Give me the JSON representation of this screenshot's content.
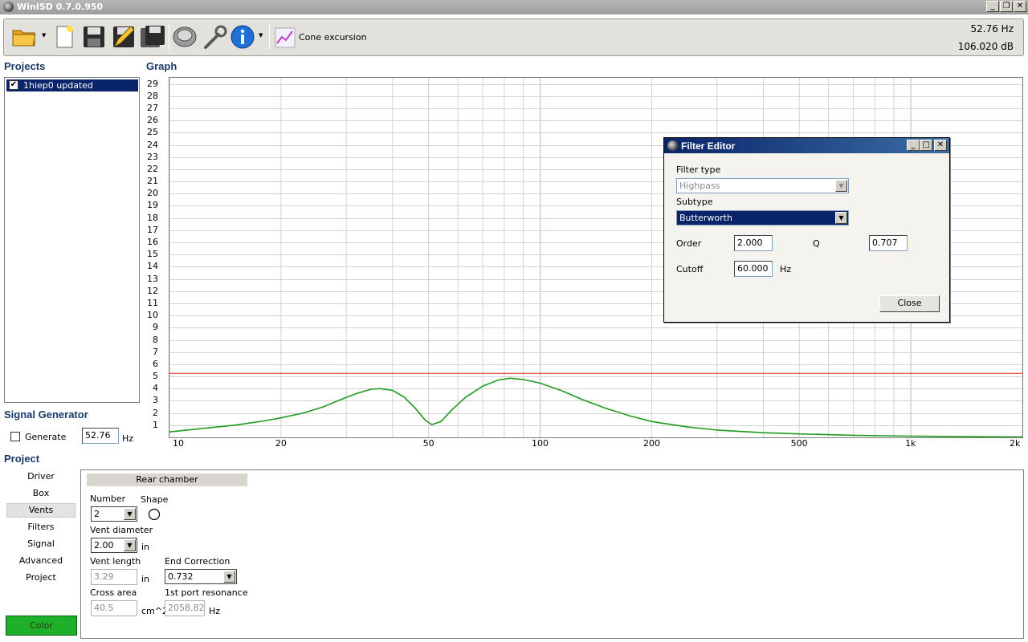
{
  "window": {
    "title": "WinISD 0.7.0.950"
  },
  "toolbar": {
    "cone_label": "Cone excursion",
    "readout_freq": "52.76 Hz",
    "readout_db": "106.020 dB"
  },
  "projects": {
    "title": "Projects",
    "items": [
      {
        "label": "1hiep0 updated",
        "checked": true
      }
    ]
  },
  "graph": {
    "title": "Graph"
  },
  "chart_data": {
    "type": "line",
    "x_scale": "log",
    "xlim": [
      10,
      2000
    ],
    "ylim": [
      0,
      29.5
    ],
    "x_ticks": [
      {
        "value": 10,
        "label": "10"
      },
      {
        "value": 20,
        "label": "20"
      },
      {
        "value": 50,
        "label": "50"
      },
      {
        "value": 100,
        "label": "100"
      },
      {
        "value": 200,
        "label": "200"
      },
      {
        "value": 500,
        "label": "500"
      },
      {
        "value": 1000,
        "label": "1k"
      },
      {
        "value": 2000,
        "label": "2k"
      }
    ],
    "y_ticks": [
      "1",
      "2",
      "3",
      "4",
      "5",
      "6",
      "7",
      "8",
      "9",
      "10",
      "11",
      "12",
      "13",
      "14",
      "15",
      "16",
      "17",
      "18",
      "19",
      "20",
      "21",
      "22",
      "23",
      "24",
      "25",
      "26",
      "27",
      "28",
      "29"
    ],
    "reference_line": {
      "y": 5.25,
      "color": "#d32020"
    },
    "series": [
      {
        "color": "#1f9a1f",
        "points": [
          [
            10,
            0.45
          ],
          [
            12,
            0.7
          ],
          [
            15,
            1.0
          ],
          [
            18,
            1.35
          ],
          [
            20,
            1.6
          ],
          [
            23,
            2.0
          ],
          [
            26,
            2.5
          ],
          [
            29,
            3.1
          ],
          [
            32,
            3.6
          ],
          [
            35,
            3.95
          ],
          [
            37,
            4.0
          ],
          [
            40,
            3.85
          ],
          [
            43,
            3.3
          ],
          [
            46,
            2.4
          ],
          [
            49,
            1.4
          ],
          [
            51,
            1.05
          ],
          [
            54,
            1.3
          ],
          [
            58,
            2.3
          ],
          [
            63,
            3.3
          ],
          [
            70,
            4.2
          ],
          [
            77,
            4.7
          ],
          [
            83,
            4.85
          ],
          [
            90,
            4.75
          ],
          [
            100,
            4.45
          ],
          [
            115,
            3.8
          ],
          [
            130,
            3.1
          ],
          [
            150,
            2.4
          ],
          [
            175,
            1.75
          ],
          [
            200,
            1.3
          ],
          [
            250,
            0.85
          ],
          [
            300,
            0.6
          ],
          [
            400,
            0.38
          ],
          [
            500,
            0.28
          ],
          [
            700,
            0.17
          ],
          [
            1000,
            0.1
          ],
          [
            1500,
            0.05
          ],
          [
            2000,
            0.03
          ]
        ]
      }
    ]
  },
  "signal_generator": {
    "title": "Signal Generator",
    "generate_label": "Generate",
    "freq_value": "52.76",
    "freq_unit": "Hz"
  },
  "project": {
    "title": "Project",
    "nav": [
      "Driver",
      "Box",
      "Vents",
      "Filters",
      "Signal",
      "Advanced",
      "Project"
    ],
    "active_nav": "Vents",
    "color_label": "Color",
    "color_value": "#1fb02a",
    "vents": {
      "chamber_header": "Rear chamber",
      "number_label": "Number",
      "number_value": "2",
      "shape_label": "Shape",
      "vent_diameter_label": "Vent diameter",
      "vent_diameter_value": "2.00",
      "vent_diameter_unit": "in",
      "vent_length_label": "Vent length",
      "vent_length_value": "3.29",
      "vent_length_unit": "in",
      "end_correction_label": "End Correction",
      "end_correction_value": "0.732",
      "cross_area_label": "Cross area",
      "cross_area_value": "40.5",
      "cross_area_unit": "cm^2",
      "port_resonance_label": "1st port resonance",
      "port_resonance_value": "2058.82",
      "port_resonance_unit": "Hz"
    }
  },
  "filter_editor": {
    "title": "Filter Editor",
    "filter_type_label": "Filter type",
    "filter_type_value": "Highpass",
    "subtype_label": "Subtype",
    "subtype_value": "Butterworth",
    "order_label": "Order",
    "order_value": "2.000",
    "q_label": "Q",
    "q_value": "0.707",
    "cutoff_label": "Cutoff",
    "cutoff_value": "60.000",
    "cutoff_unit": "Hz",
    "close_label": "Close"
  }
}
